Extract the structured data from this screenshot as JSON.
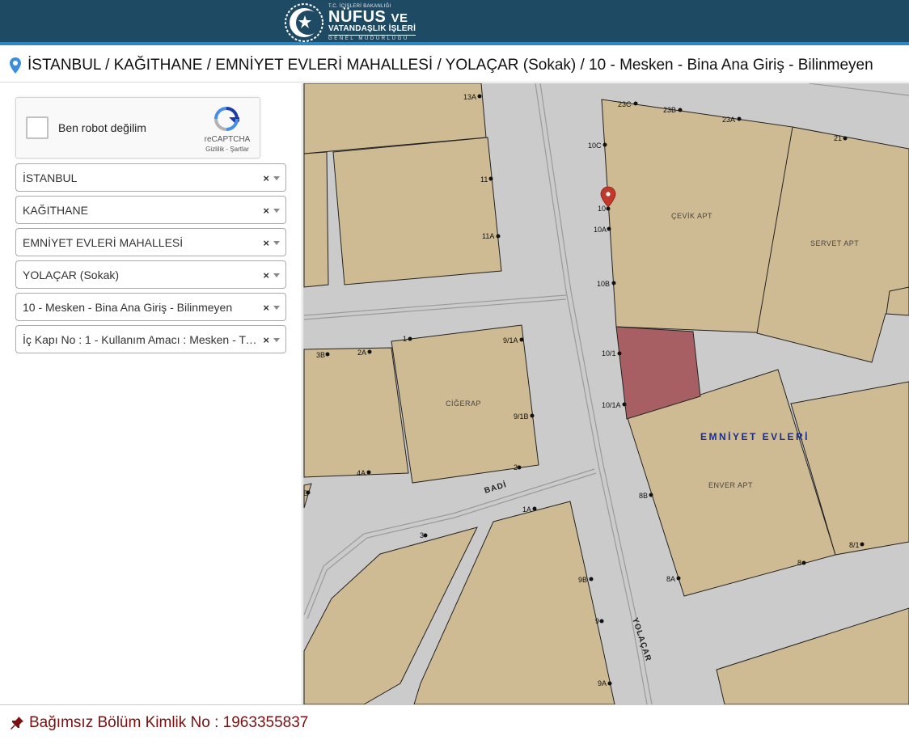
{
  "header": {
    "logo": {
      "ministry": "T.C. İÇİŞLERİ BAKANLIĞI",
      "nufus": "NÜFUS",
      "ve": "VE",
      "vatandaslik": "VATANDAŞLIK İŞLERİ",
      "genel": "GENEL MÜDÜRLÜĞÜ"
    }
  },
  "breadcrumb": {
    "icon": "map-marker-icon",
    "text": "İSTANBUL / KAĞITHANE / EMNİYET EVLERİ MAHALLESİ / YOLAÇAR (Sokak) / 10 - Mesken - Bina Ana Giriş - Bilinmeyen"
  },
  "captcha": {
    "label": "Ben robot değilim",
    "brand": "reCAPTCHA",
    "terms": "Gizlilik - Şartlar"
  },
  "selects": [
    {
      "name": "il-select",
      "value": "İSTANBUL"
    },
    {
      "name": "ilce-select",
      "value": "KAĞITHANE"
    },
    {
      "name": "mahalle-select",
      "value": "EMNİYET EVLERİ MAHALLESİ"
    },
    {
      "name": "sokak-select",
      "value": "YOLAÇAR (Sokak)"
    },
    {
      "name": "bina-select",
      "value": "10 - Mesken - Bina Ana Giriş - Bilinmeyen"
    },
    {
      "name": "ic-kapi-select",
      "value": "İç Kapı No : 1 - Kullanım Amacı : Mesken - Tip : Bilinmeyen"
    }
  ],
  "select_clear": "×",
  "map": {
    "buildings": {
      "cevik": "ÇEVİK APT",
      "servet": "SERVET APT",
      "ciger": "CİĞERAP",
      "enver": "ENVER APT"
    },
    "district": "EMNİYET EVLERİ",
    "streets": {
      "yolacar": "YOLAÇAR",
      "badi": "BADİ"
    },
    "numbers": {
      "n13a": "13A",
      "n23c": "23C",
      "n23b": "23B",
      "n23a": "23A",
      "n21": "21",
      "n10c": "10C",
      "n11": "11",
      "n11a": "11A",
      "n10": "10",
      "n10a": "10A",
      "n10b": "10B",
      "n1": "1",
      "n9_1a": "9/1A",
      "n3b": "3B",
      "n2a": "2A",
      "n10_1": "10/1",
      "n10_1a": "10/1A",
      "n9_1b": "9/1B",
      "n2": "2",
      "n4a": "4A",
      "n8b": "8B",
      "nb": "B",
      "n1a": "1A",
      "n3": "3",
      "n9b": "9B",
      "n8a": "8A",
      "n8": "8",
      "n8_1": "8/1",
      "n9": "9",
      "n9a": "9A"
    },
    "colors": {
      "parcel": "#cfbb93",
      "highlight": "#a85f63",
      "road": "#cbcbcb",
      "label": "#1a2e8c"
    }
  },
  "footer": {
    "icon": "pushpin-icon",
    "text": "Bağımsız Bölüm Kimlik No : 1963355837"
  }
}
